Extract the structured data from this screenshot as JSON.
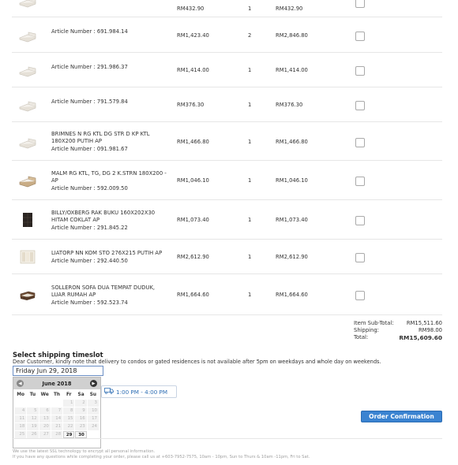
{
  "rows": [
    {
      "lines": [],
      "article": "",
      "price": "RM432.90",
      "qty": "1",
      "total": "RM432.90",
      "thumb": "bed-frame"
    },
    {
      "lines": [],
      "article": "Article Number : 691.984.14",
      "price": "RM1,423.40",
      "qty": "2",
      "total": "RM2,846.80",
      "thumb": "bed-frame"
    },
    {
      "lines": [],
      "article": "Article Number : 291.986.37",
      "price": "RM1,414.00",
      "qty": "1",
      "total": "RM1,414.00",
      "thumb": "bed-frame"
    },
    {
      "lines": [],
      "article": "Article Number : 791.579.84",
      "price": "RM376.30",
      "qty": "1",
      "total": "RM376.30",
      "thumb": "bed-frame"
    },
    {
      "lines": [
        "BRIMNES N RG KTL DG STR D KP KTL",
        "180X200 PUTIH AP"
      ],
      "article": "Article Number : 091.981.67",
      "price": "RM1,466.80",
      "qty": "1",
      "total": "RM1,466.80",
      "thumb": "bed-frame"
    },
    {
      "lines": [
        "MALM RG KTL, TG, DG 2 K.STRN 180X200 -",
        "AP"
      ],
      "article": "Article Number : 592.009.50",
      "price": "RM1,046.10",
      "qty": "1",
      "total": "RM1,046.10",
      "thumb": "bed-wood"
    },
    {
      "lines": [
        "BILLY/OXBERG RAK BUKU 160X202X30",
        "HITAM COKLAT AP"
      ],
      "article": "Article Number : 291.845.22",
      "price": "RM1,073.40",
      "qty": "1",
      "total": "RM1,073.40",
      "thumb": "bookcase"
    },
    {
      "lines": [
        "LIATORP NN KOM STO 276X215 PUTIH AP"
      ],
      "article": "Article Number : 292.440.50",
      "price": "RM2,612.90",
      "qty": "1",
      "total": "RM2,612.90",
      "thumb": "cabinet"
    },
    {
      "lines": [
        "SOLLERON SOFA DUA TEMPAT DUDUK,",
        "LUAR RUMAH AP"
      ],
      "article": "Article Number : 592.523.74",
      "price": "RM1,664.60",
      "qty": "1",
      "total": "RM1,664.60",
      "thumb": "sofa"
    }
  ],
  "summary": {
    "subtotal_label": "Item Sub-Total:",
    "subtotal": "RM15,511.60",
    "shipping_label": "Shipping:",
    "shipping": "RM98.00",
    "total_label": "Total:",
    "total": "RM15,609.60"
  },
  "shipping": {
    "title": "Select shipping timeslot",
    "note": "Dear Customer, kindly note that delivery to condos or gated residences is not available after 5pm on weekdays and whole day on weekends.",
    "date_value": "Friday Jun 29, 2018",
    "timeslot": "1:00 PM - 4:00 PM"
  },
  "calendar": {
    "month": "June 2018",
    "dow": [
      "Mo",
      "Tu",
      "We",
      "Th",
      "Fr",
      "Sa",
      "Su"
    ],
    "weeks": [
      [
        "",
        "",
        "",
        "",
        "1",
        "2",
        "3"
      ],
      [
        "4",
        "5",
        "6",
        "7",
        "8",
        "9",
        "10"
      ],
      [
        "11",
        "12",
        "13",
        "14",
        "15",
        "16",
        "17"
      ],
      [
        "18",
        "19",
        "20",
        "21",
        "22",
        "23",
        "24"
      ],
      [
        "25",
        "26",
        "27",
        "28",
        "29",
        "30",
        ""
      ]
    ],
    "enabled": [
      "29",
      "30"
    ],
    "selected": "29"
  },
  "order_button": "Order Confirmation",
  "footer": {
    "line1": "We use the latest SSL technology to encrypt all personal information.",
    "line2": "If you have any questions while completing your order, please call us at +603-7952-7575, 10am - 10pm, Sun to Thurs & 10am -11pm, Fri to Sat."
  }
}
